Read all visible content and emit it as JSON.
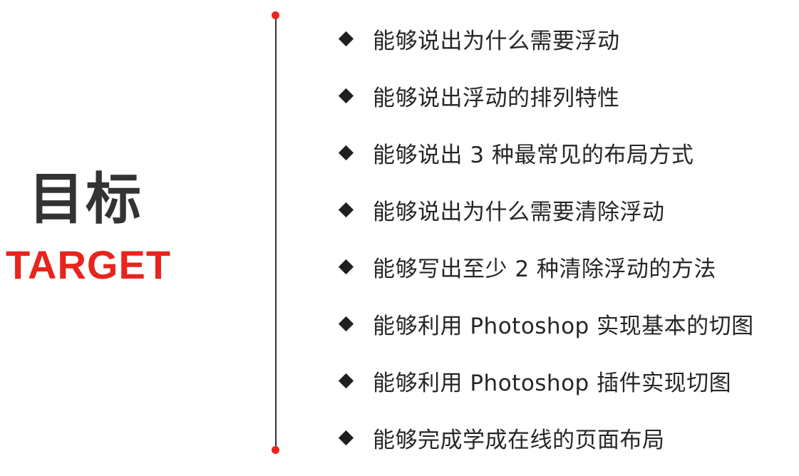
{
  "left_panel": {
    "title_cn": "目标",
    "title_en": "TARGET"
  },
  "goals": [
    {
      "text": "能够说出为什么需要浮动"
    },
    {
      "text": "能够说出浮动的排列特性"
    },
    {
      "text": "能够说出 3 种最常见的布局方式"
    },
    {
      "text": "能够说出为什么需要清除浮动"
    },
    {
      "text": "能够写出至少 2 种清除浮动的方法"
    },
    {
      "text": "能够利用 Photoshop 实现基本的切图"
    },
    {
      "text": "能够利用 Photoshop 插件实现切图"
    },
    {
      "text": "能够完成学成在线的页面布局"
    }
  ],
  "colors": {
    "accent": "#e8241c",
    "text": "#262626",
    "title": "#333333",
    "line": "#333333"
  },
  "icons": {
    "bullet": "diamond-bullet-icon",
    "timeline_endpoint": "red-dot"
  }
}
